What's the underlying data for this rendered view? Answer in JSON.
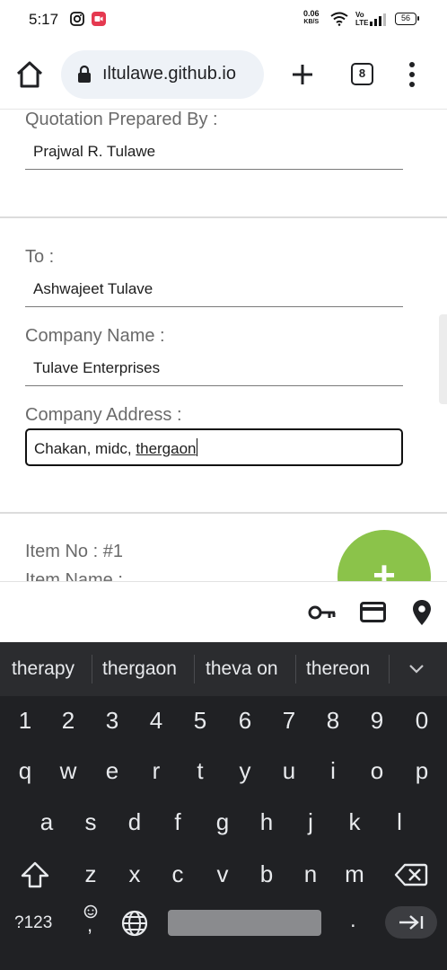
{
  "status_bar": {
    "time": "5:17",
    "speed_value": "0.06",
    "speed_unit": "KB/S",
    "volte_top": "Vo",
    "volte_bottom": "LTE",
    "battery": "56"
  },
  "browser": {
    "url": "ıltulawe.github.io",
    "tab_count": "8"
  },
  "form": {
    "prepared_by_label": "Quotation Prepared By :",
    "prepared_by_value": "Prajwal R. Tulawe",
    "to_label": "To :",
    "to_value": "Ashwajeet Tulave",
    "company_name_label": "Company Name :",
    "company_name_value": "Tulave Enterprises",
    "company_address_label": "Company Address :",
    "company_address_prefix": "Chakan, midc, ",
    "company_address_composing": "thergaon",
    "item_no_label": "Item No : #1",
    "item_name_label": "Item Name :",
    "fab_label": "+"
  },
  "keyboard": {
    "suggestions": [
      "therapy",
      "thergaon",
      "theva on",
      "thereon"
    ],
    "number_row": [
      "1",
      "2",
      "3",
      "4",
      "5",
      "6",
      "7",
      "8",
      "9",
      "0"
    ],
    "row1": [
      "q",
      "w",
      "e",
      "r",
      "t",
      "y",
      "u",
      "i",
      "o",
      "p"
    ],
    "row2": [
      "a",
      "s",
      "d",
      "f",
      "g",
      "h",
      "j",
      "k",
      "l"
    ],
    "row3": [
      "z",
      "x",
      "c",
      "v",
      "b",
      "n",
      "m"
    ],
    "symbols_key": "?123",
    "comma_key": ",",
    "period_key": "."
  },
  "colors": {
    "fab": "#8bc34a",
    "keyboard_bg": "#202124",
    "url_pill": "#eef2f7"
  }
}
